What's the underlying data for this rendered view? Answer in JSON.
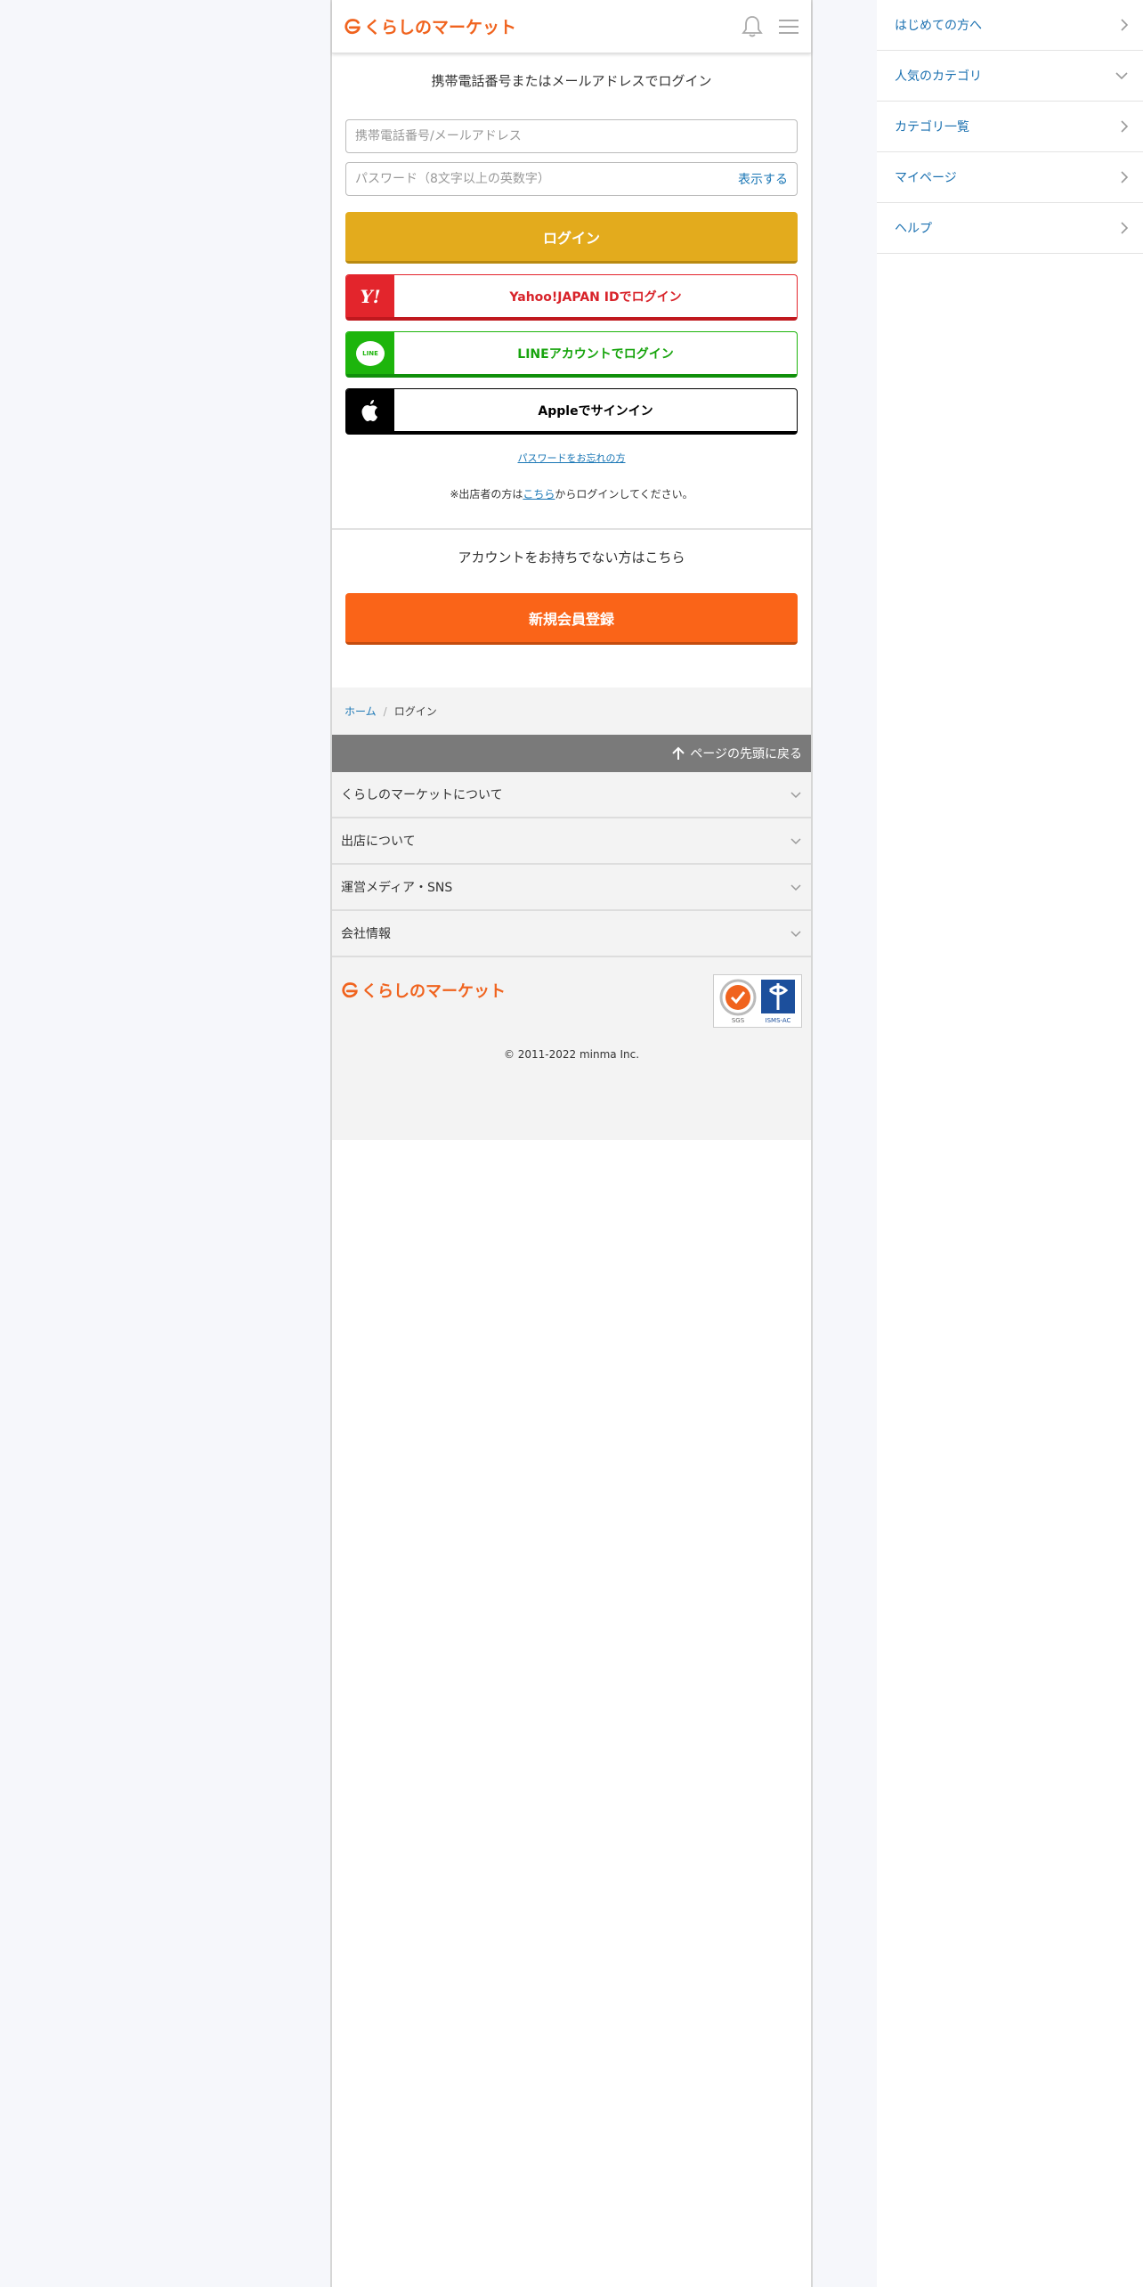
{
  "header": {
    "logo_text": "くらしのマーケット",
    "icons": [
      "bell-icon",
      "hamburger-menu-icon"
    ]
  },
  "login": {
    "heading": "携帯電話番号またはメールアドレスでログイン",
    "id_placeholder": "携帯電話番号/メールアドレス",
    "password_placeholder": "パスワード（8文字以上の英数字）",
    "show_password": "表示する",
    "login_button": "ログイン",
    "yahoo_button": "Yahoo!JAPAN IDでログイン",
    "yahoo_icon_text": "Y!",
    "line_button": "LINEアカウントでログイン",
    "line_icon_text": "LINE",
    "apple_button": "Appleでサインイン",
    "forgot_password": "パスワードをお忘れの方",
    "seller_prefix": "※出店者の方は",
    "seller_link": "こちら",
    "seller_suffix": "からログインしてください。"
  },
  "register": {
    "heading": "アカウントをお持ちでない方はこちら",
    "button": "新規会員登録"
  },
  "breadcrumb": {
    "home": "ホーム",
    "separator": "/",
    "current": "ログイン"
  },
  "footer": {
    "to_top": "ページの先頭に戻る",
    "accordion": [
      "くらしのマーケットについて",
      "出店について",
      "運営メディア・SNS",
      "会社情報"
    ],
    "logo_text": "くらしのマーケット",
    "cert_left": "SGS",
    "cert_right": "ISMS-AC",
    "copyright": "© 2011-2022 minma Inc."
  },
  "side_nav": [
    {
      "label": "はじめての方へ",
      "icon": "chevron-right-icon"
    },
    {
      "label": "人気のカテゴリ",
      "icon": "chevron-down-icon"
    },
    {
      "label": "カテゴリ一覧",
      "icon": "chevron-right-icon"
    },
    {
      "label": "マイページ",
      "icon": "chevron-right-icon"
    },
    {
      "label": "ヘルプ",
      "icon": "chevron-right-icon"
    }
  ],
  "colors": {
    "brand_orange": "#f0631e",
    "login_yellow": "#e3ab1d",
    "register_orange": "#fa6418",
    "yahoo_red": "#e3252c",
    "line_green": "#1db50c",
    "link_blue": "#1976b5"
  }
}
